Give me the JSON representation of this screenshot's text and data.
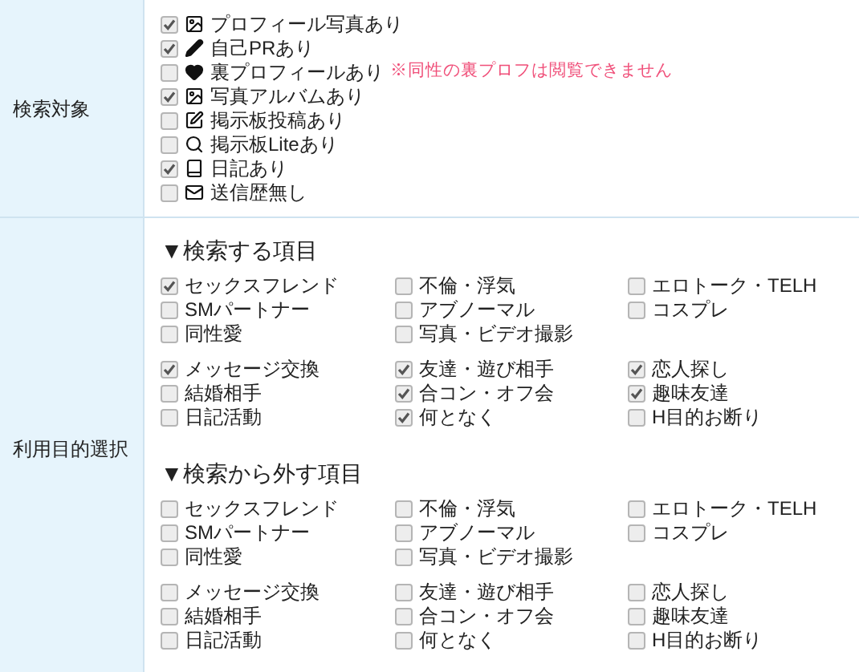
{
  "rows": [
    {
      "label": "検索対象",
      "kind": "targets",
      "items": [
        {
          "kind": "image",
          "label": "プロフィール写真あり",
          "checked": true
        },
        {
          "kind": "pencil",
          "label": "自己PRあり",
          "checked": true
        },
        {
          "kind": "heart",
          "label": "裏プロフィールあり",
          "checked": false,
          "note": "※同性の裏プロフは閲覧できません"
        },
        {
          "kind": "image",
          "label": "写真アルバムあり",
          "checked": true
        },
        {
          "kind": "edit",
          "label": "掲示板投稿あり",
          "checked": false
        },
        {
          "kind": "search",
          "label": "掲示板Liteあり",
          "checked": false
        },
        {
          "kind": "book",
          "label": "日記あり",
          "checked": true
        },
        {
          "kind": "mail",
          "label": "送信歴無し",
          "checked": false
        }
      ]
    },
    {
      "label": "利用目的選択",
      "kind": "purposes",
      "sections": [
        {
          "heading": "▼検索する項目",
          "groups": [
            [
              {
                "label": "セックスフレンド",
                "checked": true
              },
              {
                "label": "不倫・浮気",
                "checked": false
              },
              {
                "label": "エロトーク・TELH",
                "checked": false
              },
              {
                "label": "SMパートナー",
                "checked": false
              },
              {
                "label": "アブノーマル",
                "checked": false
              },
              {
                "label": "コスプレ",
                "checked": false
              },
              {
                "label": "同性愛",
                "checked": false
              },
              {
                "label": "写真・ビデオ撮影",
                "checked": false
              }
            ],
            [
              {
                "label": "メッセージ交換",
                "checked": true
              },
              {
                "label": "友達・遊び相手",
                "checked": true
              },
              {
                "label": "恋人探し",
                "checked": true
              },
              {
                "label": "結婚相手",
                "checked": false
              },
              {
                "label": "合コン・オフ会",
                "checked": true
              },
              {
                "label": "趣味友達",
                "checked": true
              },
              {
                "label": "日記活動",
                "checked": false
              },
              {
                "label": "何となく",
                "checked": true
              },
              {
                "label": "H目的お断り",
                "checked": false
              }
            ]
          ]
        },
        {
          "heading": "▼検索から外す項目",
          "groups": [
            [
              {
                "label": "セックスフレンド",
                "checked": false
              },
              {
                "label": "不倫・浮気",
                "checked": false
              },
              {
                "label": "エロトーク・TELH",
                "checked": false
              },
              {
                "label": "SMパートナー",
                "checked": false
              },
              {
                "label": "アブノーマル",
                "checked": false
              },
              {
                "label": "コスプレ",
                "checked": false
              },
              {
                "label": "同性愛",
                "checked": false
              },
              {
                "label": "写真・ビデオ撮影",
                "checked": false
              }
            ],
            [
              {
                "label": "メッセージ交換",
                "checked": false
              },
              {
                "label": "友達・遊び相手",
                "checked": false
              },
              {
                "label": "恋人探し",
                "checked": false
              },
              {
                "label": "結婚相手",
                "checked": false
              },
              {
                "label": "合コン・オフ会",
                "checked": false
              },
              {
                "label": "趣味友達",
                "checked": false
              },
              {
                "label": "日記活動",
                "checked": false
              },
              {
                "label": "何となく",
                "checked": false
              },
              {
                "label": "H目的お断り",
                "checked": false
              }
            ]
          ]
        }
      ]
    }
  ]
}
